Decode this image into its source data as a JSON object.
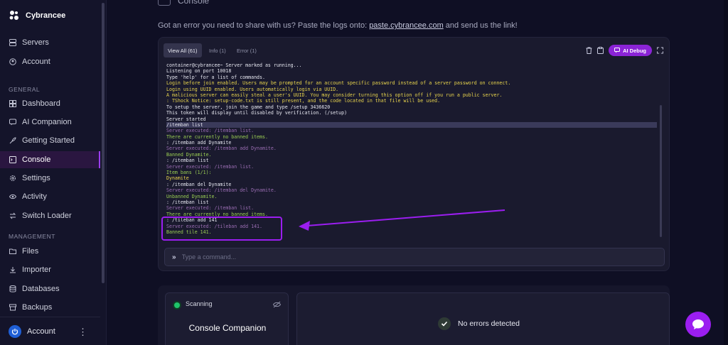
{
  "brand": {
    "name": "Cybrancee"
  },
  "sidebar": {
    "top_items": [
      {
        "label": "Servers",
        "icon": "server-icon"
      },
      {
        "label": "Account",
        "icon": "account-icon"
      }
    ],
    "general_label": "GENERAL",
    "general_items": [
      {
        "label": "Dashboard",
        "icon": "dashboard-icon"
      },
      {
        "label": "AI Companion",
        "icon": "ai-companion-icon"
      },
      {
        "label": "Getting Started",
        "icon": "rocket-icon"
      },
      {
        "label": "Console",
        "icon": "console-icon",
        "active": true
      },
      {
        "label": "Settings",
        "icon": "gear-icon"
      },
      {
        "label": "Activity",
        "icon": "eye-icon"
      },
      {
        "label": "Switch Loader",
        "icon": "switch-icon"
      }
    ],
    "management_label": "MANAGEMENT",
    "management_items": [
      {
        "label": "Files",
        "icon": "folder-icon"
      },
      {
        "label": "Importer",
        "icon": "download-icon"
      },
      {
        "label": "Databases",
        "icon": "database-icon"
      },
      {
        "label": "Backups",
        "icon": "backup-icon"
      }
    ],
    "account_label": "Account"
  },
  "page": {
    "title": "Console",
    "hint_before": "Got an error you need to share with us? Paste the logs onto: ",
    "hint_link": "paste.cybrancee.com",
    "hint_after": " and send us the link!"
  },
  "console": {
    "tabs": [
      {
        "label": "View All (61)",
        "active": true
      },
      {
        "label": "Info (1)"
      },
      {
        "label": "Error (1)"
      }
    ],
    "ai_debug_label": "AI Debug",
    "input_placeholder": "Type a command...",
    "log_lines": [
      {
        "text": "container@cybrancee~ Server marked as running...",
        "color": "white"
      },
      {
        "text": "Listening on port 10018",
        "color": "white"
      },
      {
        "text": "Type 'help' for a list of commands.",
        "color": "white"
      },
      {
        "text": "Login before join enabled. Users may be prompted for an account specific password instead of a server password on connect.",
        "color": "yellow"
      },
      {
        "text": "Login using UUID enabled. Users automatically login via UUID.",
        "color": "yellow"
      },
      {
        "text": "A malicious server can easily steal a user's UUID. You may consider turning this option off if you run a public server.",
        "color": "yellow"
      },
      {
        "text": ": TShock Notice: setup-code.txt is still present, and the code located in that file will be used.",
        "color": "yellow"
      },
      {
        "text": "To setup the server, join the game and type /setup 3436620",
        "color": "white"
      },
      {
        "text": "This token will display until disabled by verification. (/setup)",
        "color": "white"
      },
      {
        "text": "Server started",
        "color": "white"
      },
      {
        "text": "/itemban list",
        "color": "hl"
      },
      {
        "text": "Server executed: /itemban list.",
        "color": "purple"
      },
      {
        "text": "There are currently no banned items.",
        "color": "green"
      },
      {
        "text": ": /itemban add Dynamite",
        "color": "white"
      },
      {
        "text": "Server executed: /itemban add Dynamite.",
        "color": "purple"
      },
      {
        "text": "Banned Dynamite.",
        "color": "green"
      },
      {
        "text": ": /itemban list",
        "color": "white"
      },
      {
        "text": "Server executed: /itemban list.",
        "color": "purple"
      },
      {
        "text": "Item bans (1/1):",
        "color": "green"
      },
      {
        "text": "Dynamite",
        "color": "yellow"
      },
      {
        "text": ": /itemban del Dynamite",
        "color": "white"
      },
      {
        "text": "Server executed: /itemban del Dynamite.",
        "color": "purple"
      },
      {
        "text": "Unbanned Dynamite.",
        "color": "green"
      },
      {
        "text": ": /itemban list",
        "color": "white"
      },
      {
        "text": "Server executed: /itemban list.",
        "color": "purple"
      },
      {
        "text": "There are currently no banned items.",
        "color": "green"
      },
      {
        "text": ": /tileban add 141",
        "color": "white"
      },
      {
        "text": "Server executed: /tileban add 141.",
        "color": "purple"
      },
      {
        "text": "Banned tile 141.",
        "color": "green"
      }
    ]
  },
  "companion": {
    "scan_label": "Scanning",
    "title": "Console Companion",
    "status_text": "No errors detected"
  },
  "colors": {
    "accent": "#9b1ef0",
    "log_white": "#e6e7f0",
    "log_yellow": "#e8d44d",
    "log_purple": "#9a6db3",
    "log_green": "#9bcf53"
  }
}
